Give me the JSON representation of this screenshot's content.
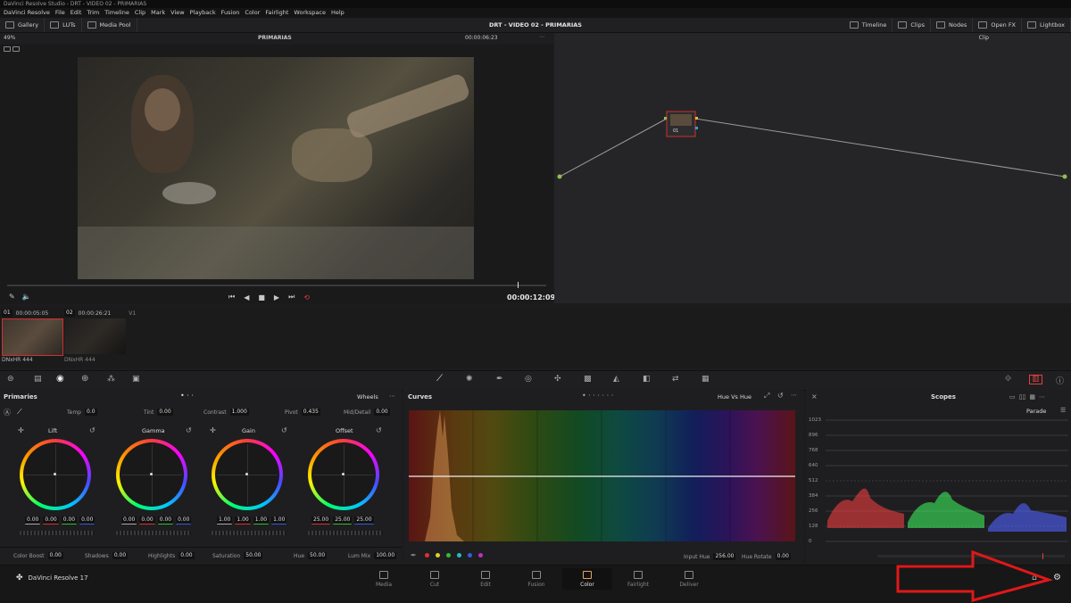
{
  "window_title": "DaVinci Resolve Studio - DRT - VIDEO 02 - PRIMARIAS",
  "menu": [
    "DaVinci Resolve",
    "File",
    "Edit",
    "Trim",
    "Timeline",
    "Clip",
    "Mark",
    "View",
    "Playback",
    "Fusion",
    "Color",
    "Fairlight",
    "Workspace",
    "Help"
  ],
  "toolbar": {
    "left": [
      "Gallery",
      "LUTs",
      "Media Pool"
    ],
    "project_title": "DRT - VIDEO 02 - PRIMARIAS",
    "right": [
      "Timeline",
      "Clips",
      "Nodes",
      "Open FX",
      "Lightbox"
    ]
  },
  "viewer": {
    "zoom": "49%",
    "clip_name": "PRIMARIAS",
    "timecode_top": "00:00:06:23",
    "timecode_bottom": "00:00:12:09"
  },
  "node_editor": {
    "mode": "Clip",
    "node_label": "01"
  },
  "clips": [
    {
      "index": "01",
      "timecode": "00:00:05:05",
      "track": "V1",
      "codec": "DNxHR 444"
    },
    {
      "index": "02",
      "timecode": "00:00:26:21",
      "track": "V1",
      "codec": "DNxHR 444"
    }
  ],
  "primaries": {
    "title": "Primaries",
    "mode": "Wheels",
    "top_params": [
      {
        "label": "Temp",
        "value": "0.0"
      },
      {
        "label": "Tint",
        "value": "0.00"
      },
      {
        "label": "Contrast",
        "value": "1.000"
      },
      {
        "label": "Pivot",
        "value": "0.435"
      },
      {
        "label": "Mid/Detail",
        "value": "0.00"
      }
    ],
    "wheels": [
      {
        "name": "Lift",
        "values": [
          "0.00",
          "0.00",
          "0.00",
          "0.00"
        ]
      },
      {
        "name": "Gamma",
        "values": [
          "0.00",
          "0.00",
          "0.00",
          "0.00"
        ]
      },
      {
        "name": "Gain",
        "values": [
          "1.00",
          "1.00",
          "1.00",
          "1.00"
        ]
      },
      {
        "name": "Offset",
        "values": [
          "25.00",
          "25.00",
          "25.00"
        ]
      }
    ],
    "bottom_params": [
      {
        "label": "Color Boost",
        "value": "0.00"
      },
      {
        "label": "Shadows",
        "value": "0.00"
      },
      {
        "label": "Highlights",
        "value": "0.00"
      },
      {
        "label": "Saturation",
        "value": "50.00"
      },
      {
        "label": "Hue",
        "value": "50.00"
      },
      {
        "label": "Lum Mix",
        "value": "100.00"
      }
    ]
  },
  "curves": {
    "title": "Curves",
    "mode": "Hue Vs Hue",
    "input_hue_label": "Input Hue",
    "input_hue": "256.00",
    "hue_rotate_label": "Hue Rotate",
    "hue_rotate": "0.00",
    "swatches": [
      "#e03030",
      "#e0d020",
      "#30c030",
      "#20c0c0",
      "#3060e0",
      "#c030c0"
    ]
  },
  "scopes": {
    "title": "Scopes",
    "mode": "Parade",
    "scale": [
      "1023",
      "896",
      "768",
      "640",
      "512",
      "384",
      "256",
      "128",
      "0"
    ]
  },
  "pages": [
    "Media",
    "Cut",
    "Edit",
    "Fusion",
    "Color",
    "Fairlight",
    "Deliver"
  ],
  "active_page": "Color",
  "app_name": "DaVinci Resolve 17",
  "colors": {
    "accent": "#e8a25a",
    "annotation_arrow": "#e01818"
  }
}
